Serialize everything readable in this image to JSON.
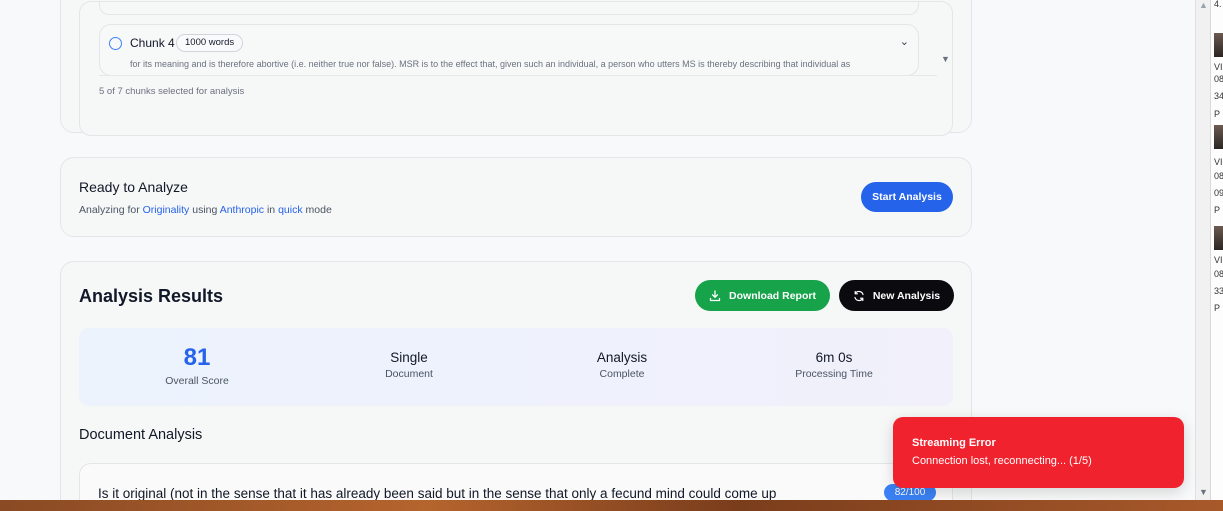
{
  "chunks": {
    "current": {
      "title": "Chunk 4",
      "word_count": "1000 words",
      "excerpt": "for its meaning and is therefore abortive (i.e. neither true nor false). MSR is to the effect that, given such an individual, a person who utters MS is thereby describing that individual as"
    },
    "selection_status": "5 of 7 chunks selected for analysis"
  },
  "ready": {
    "title": "Ready to Analyze",
    "prefix": "Analyzing for",
    "analysis_type": "Originality",
    "using": "using",
    "provider": "Anthropic",
    "in": "in",
    "mode": "quick",
    "mode_suffix": "mode",
    "start_label": "Start Analysis"
  },
  "results": {
    "title": "Analysis Results",
    "download_label": "Download Report",
    "new_label": "New Analysis",
    "stats": [
      {
        "value": "81",
        "label": "Overall Score"
      },
      {
        "value": "Single",
        "label": "Document"
      },
      {
        "value": "Analysis",
        "label": "Complete"
      },
      {
        "value": "6m 0s",
        "label": "Processing Time"
      }
    ],
    "document_section_title": "Document Analysis",
    "document_item": {
      "text": "Is it original (not in the sense that it has already been said but in the sense that only a fecund mind could come up",
      "score": "82/100"
    }
  },
  "toast": {
    "title": "Streaming Error",
    "message": "Connection lost, reconnecting... (1/5)"
  },
  "side_panel": {
    "labels": [
      "4.",
      "VI",
      "08",
      "34",
      "P",
      "VI",
      "08",
      "09",
      "P",
      "VI",
      "08",
      "33",
      "P"
    ]
  },
  "colors": {
    "primary": "#2563eb",
    "success": "#16a34a",
    "dark_button": "#0b0b0f",
    "error": "#f0222e"
  },
  "icons": {
    "download": "download-icon",
    "refresh": "refresh-icon",
    "chevron": "chevron-down-icon",
    "radio": "radio-icon"
  }
}
